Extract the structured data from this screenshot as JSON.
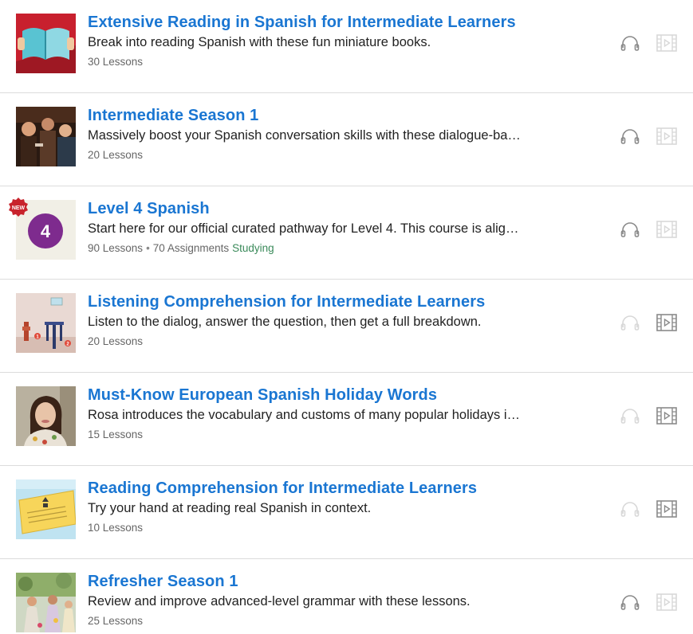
{
  "colors": {
    "title": "#1a76d2",
    "icon_active": "#8a8a8a",
    "icon_inactive": "#d8d8d8",
    "status": "#3a8a5a",
    "new_badge": "#c8232c"
  },
  "courses": [
    {
      "title": "Extensive Reading in Spanish for Intermediate Learners",
      "description": "Break into reading Spanish with these fun miniature books.",
      "lessons": "30 Lessons",
      "thumbnail": "open-book-thumbnail",
      "audio_available": true,
      "video_available": false
    },
    {
      "title": "Intermediate Season 1",
      "description": "Massively boost your Spanish conversation skills with these dialogue-ba…",
      "lessons": "20 Lessons",
      "thumbnail": "crowd-photo-thumbnail",
      "audio_available": true,
      "video_available": false
    },
    {
      "title": "Level 4 Spanish",
      "description": "Start here for our official curated pathway for Level 4. This course is alig…",
      "lessons": "90 Lessons",
      "assignments": "70 Assignments",
      "status": "Studying",
      "badge": "NEW",
      "level_number": "4",
      "thumbnail": "level-4-thumbnail",
      "audio_available": true,
      "video_available": false
    },
    {
      "title": "Listening Comprehension for Intermediate Learners",
      "description": "Listen to the dialog, answer the question, then get a full breakdown.",
      "lessons": "20 Lessons",
      "thumbnail": "illustration-thumbnail",
      "thumb_num_1": "1",
      "thumb_num_2": "2",
      "audio_available": false,
      "video_available": true
    },
    {
      "title": "Must-Know European Spanish Holiday Words",
      "description": "Rosa introduces the vocabulary and customs of many popular holidays i…",
      "lessons": "15 Lessons",
      "thumbnail": "presenter-photo-thumbnail",
      "audio_available": false,
      "video_available": true
    },
    {
      "title": "Reading Comprehension for Intermediate Learners",
      "description": "Try your hand at reading real Spanish in context.",
      "lessons": "10 Lessons",
      "thumbnail": "sign-thumbnail",
      "audio_available": false,
      "video_available": true
    },
    {
      "title": "Refresher Season 1",
      "description": "Review and improve advanced-level grammar with these lessons.",
      "lessons": "25 Lessons",
      "thumbnail": "festival-photo-thumbnail",
      "audio_available": true,
      "video_available": false
    }
  ]
}
